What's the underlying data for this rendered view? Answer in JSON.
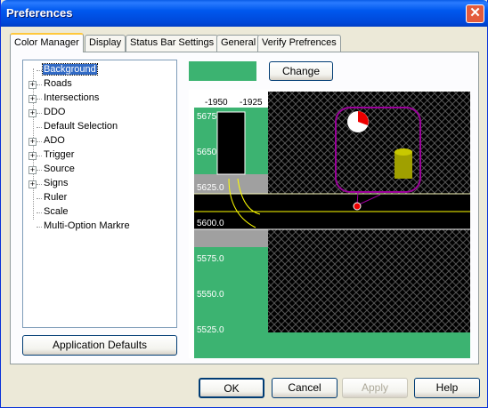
{
  "window": {
    "title": "Preferences"
  },
  "tabs": [
    {
      "label": "Color Manager",
      "active": true
    },
    {
      "label": "Display",
      "active": false
    },
    {
      "label": "Status Bar Settings",
      "active": false
    },
    {
      "label": "General",
      "active": false
    },
    {
      "label": "Verify Prefrences",
      "active": false
    }
  ],
  "tree": {
    "items": [
      {
        "label": "Background",
        "expandable": false,
        "selected": true
      },
      {
        "label": "Roads",
        "expandable": true
      },
      {
        "label": "Intersections",
        "expandable": true
      },
      {
        "label": "DDO",
        "expandable": true
      },
      {
        "label": "Default Selection",
        "expandable": false
      },
      {
        "label": "ADO",
        "expandable": true
      },
      {
        "label": "Trigger",
        "expandable": true
      },
      {
        "label": "Source",
        "expandable": true
      },
      {
        "label": "Signs",
        "expandable": true
      },
      {
        "label": "Ruler",
        "expandable": false
      },
      {
        "label": "Scale",
        "expandable": false
      },
      {
        "label": "Multi-Option Markre",
        "expandable": false
      }
    ]
  },
  "color_swatch": {
    "color": "#3cb371"
  },
  "buttons": {
    "change": "Change",
    "application_defaults": "Application Defaults",
    "ok": "OK",
    "cancel": "Cancel",
    "apply": "Apply",
    "help": "Help"
  },
  "preview": {
    "ruler_top": [
      "-1950",
      "-1925"
    ],
    "ruler_left": [
      "5675",
      "5650",
      "5625.0",
      "5600.0",
      "5575.0",
      "5550.0",
      "5525.0"
    ],
    "colors": {
      "background": "#3cb371",
      "road": "#000000",
      "grid": "#404040",
      "ruler": "#ffffff",
      "trigger": "#9b009b"
    }
  }
}
